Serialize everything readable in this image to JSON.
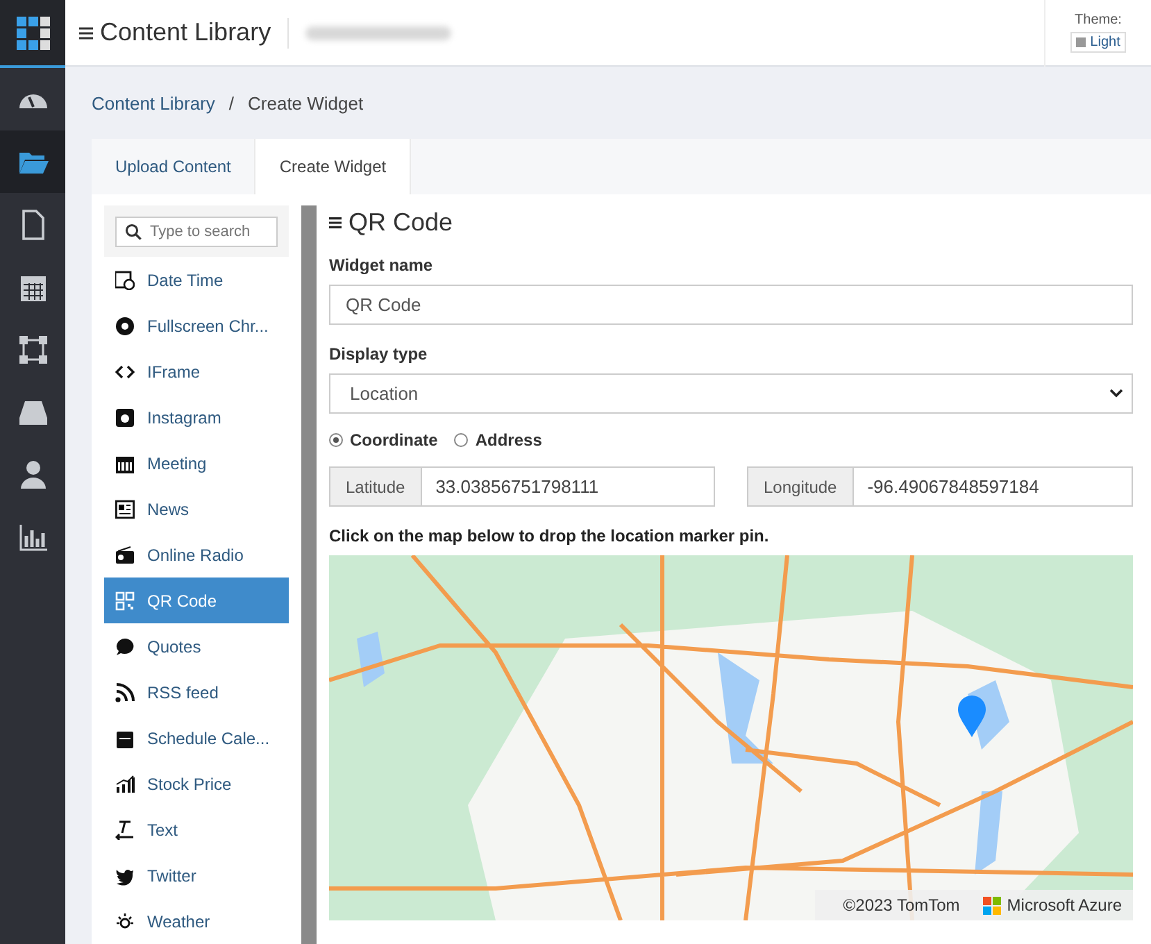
{
  "header": {
    "title": "Content Library",
    "theme_label": "Theme:",
    "theme_button": "Light"
  },
  "nav": [
    {
      "kind": "dashboard",
      "selected": false
    },
    {
      "kind": "folder",
      "selected": true
    },
    {
      "kind": "file",
      "selected": false
    },
    {
      "kind": "calendar",
      "selected": false
    },
    {
      "kind": "network",
      "selected": false
    },
    {
      "kind": "drive",
      "selected": false
    },
    {
      "kind": "user",
      "selected": false
    },
    {
      "kind": "chart",
      "selected": false
    }
  ],
  "breadcrumb": {
    "items": [
      "Content Library",
      "Create Widget"
    ],
    "separator": "/"
  },
  "tabs": [
    {
      "label": "Upload Content",
      "selected": false
    },
    {
      "label": "Create Widget",
      "selected": true
    }
  ],
  "widget_list": {
    "search_placeholder": "Type to search",
    "items": [
      {
        "label": "Date Time",
        "kind": "datetime",
        "selected": false
      },
      {
        "label": "Fullscreen Chr...",
        "kind": "browser",
        "selected": false
      },
      {
        "label": "IFrame",
        "kind": "code",
        "selected": false
      },
      {
        "label": "Instagram",
        "kind": "camera",
        "selected": false
      },
      {
        "label": "Meeting",
        "kind": "calendar",
        "selected": false
      },
      {
        "label": "News",
        "kind": "news",
        "selected": false
      },
      {
        "label": "Online Radio",
        "kind": "radio",
        "selected": false
      },
      {
        "label": "QR Code",
        "kind": "qr",
        "selected": true
      },
      {
        "label": "Quotes",
        "kind": "quote",
        "selected": false
      },
      {
        "label": "RSS feed",
        "kind": "rss",
        "selected": false
      },
      {
        "label": "Schedule Cale...",
        "kind": "schedule",
        "selected": false
      },
      {
        "label": "Stock Price",
        "kind": "stock",
        "selected": false
      },
      {
        "label": "Text",
        "kind": "text",
        "selected": false
      },
      {
        "label": "Twitter",
        "kind": "bird",
        "selected": false
      },
      {
        "label": "Weather",
        "kind": "sun",
        "selected": false
      }
    ]
  },
  "form": {
    "title": "QR Code",
    "name_label": "Widget name",
    "name_value": "QR Code",
    "display_label": "Display type",
    "display_value": "Location",
    "location_modes": [
      {
        "label": "Coordinate",
        "selected": true
      },
      {
        "label": "Address",
        "selected": false
      }
    ],
    "latitude_label": "Latitude",
    "latitude_value": "33.03856751798111",
    "longitude_label": "Longitude",
    "longitude_value": "-96.49067848597184",
    "map_hint": "Click on the map below to drop the location marker pin.",
    "map": {
      "attribution": "©2023 TomTom",
      "provider": "Microsoft Azure"
    }
  }
}
